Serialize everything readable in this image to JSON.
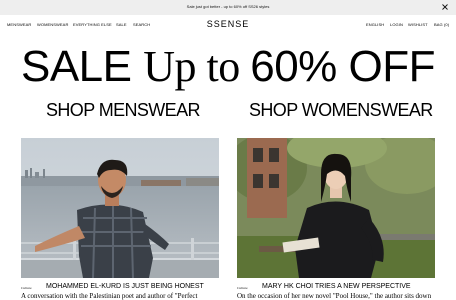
{
  "banner": {
    "text": "Sale just got better - up to 60% off SS26 styles",
    "close_icon": "close-icon"
  },
  "nav": {
    "left_items": [
      "MENSWEAR",
      "WOMENSWEAR",
      "EVERYTHING ELSE",
      "SALE",
      "SEARCH"
    ],
    "logo": "SSENSE",
    "right_items": [
      "ENGLISH",
      "LOGIN",
      "WISHLIST",
      "BAG (0)"
    ]
  },
  "hero": {
    "sale_part1": "SALE ",
    "sale_part2": "Up to ",
    "sale_part3": "60% OFF"
  },
  "shop_links": {
    "menswear": "SHOP MENSWEAR",
    "womenswear": "SHOP WOMENSWEAR"
  },
  "editorials": [
    {
      "tag": "Culture",
      "title": "MOHAMMED EL-KURD IS JUST BEING HONEST",
      "description": "A conversation with the Palestinian poet and author of \"Perfect"
    },
    {
      "tag": "Culture",
      "title": "MARY HK CHOI TRIES A NEW PERSPECTIVE",
      "description": "On the occasion of her new novel \"Pool House,\" the author sits down"
    }
  ],
  "colors": {
    "banner_bg": "#eeeeee",
    "text": "#000000",
    "background": "#ffffff"
  }
}
